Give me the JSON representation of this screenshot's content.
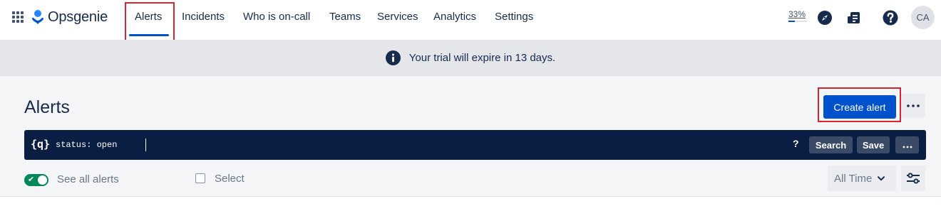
{
  "app": {
    "name": "Opsgenie"
  },
  "nav": {
    "items": [
      {
        "label": "Alerts",
        "active": true
      },
      {
        "label": "Incidents"
      },
      {
        "label": "Who is on-call"
      },
      {
        "label": "Teams"
      },
      {
        "label": "Services"
      },
      {
        "label": "Analytics"
      },
      {
        "label": "Settings"
      }
    ],
    "progress_label": "33%",
    "progress_value": 0.33,
    "icons": [
      "app-switcher-icon",
      "compass-icon",
      "release-notes-icon",
      "help-icon"
    ],
    "avatar_initials": "CA"
  },
  "banner": {
    "text": "Your trial will expire in 13 days.",
    "icon": "info-icon"
  },
  "page": {
    "title": "Alerts",
    "create_label": "Create alert",
    "more_label": "•••"
  },
  "search": {
    "icon_label": "{q}",
    "query": "status: open",
    "help_label": "?",
    "search_label": "Search",
    "save_label": "Save",
    "more_label": "•••"
  },
  "filters": {
    "see_all_label": "See all alerts",
    "see_all_on": true,
    "select_label": "Select",
    "time_value": "All Time"
  },
  "colors": {
    "accent": "#0052cc",
    "highlight": "#d6252e",
    "toggle_on": "#00875a",
    "search_bg": "#091e42",
    "banner_bg": "#e4e6ea"
  }
}
